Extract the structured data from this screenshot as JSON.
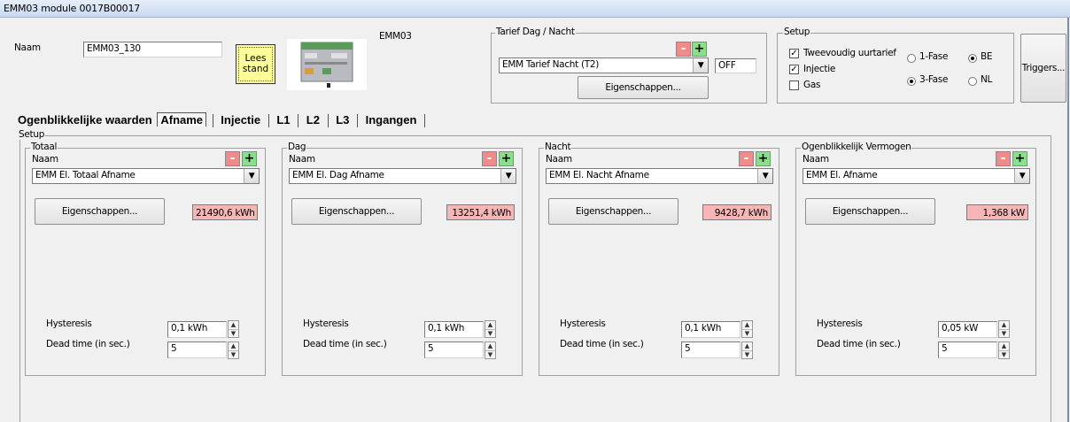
{
  "window": {
    "title": "EMM03 module 0017B00017"
  },
  "module": {
    "naam_label": "Naam",
    "naam_value": "EMM03_130",
    "lees_label_line1": "Lees",
    "lees_label_line2": "stand",
    "type_label": "EMM03"
  },
  "tarief": {
    "group_title": "Tarief Dag / Nacht",
    "selected": "EMM Tarief Nacht (T2)",
    "state": "OFF",
    "eigenschappen": "Eigenschappen..."
  },
  "setup_top": {
    "group_title": "Setup",
    "tweevoudig": "Tweevoudig uurtarief",
    "injectie": "Injectie",
    "gas": "Gas",
    "fase1": "1-Fase",
    "fase3": "3-Fase",
    "be": "BE",
    "nl": "NL",
    "tweevoudig_checked": true,
    "injectie_checked": true,
    "gas_checked": false,
    "fase_selected": "3-Fase",
    "land_selected": "BE"
  },
  "triggers_label": "Triggers...",
  "tabs": [
    "Ogenblikkelijke waarden",
    "Afname",
    "Injectie",
    "L1",
    "L2",
    "L3",
    "Ingangen"
  ],
  "active_tab": "Afname",
  "setup_title": "Setup",
  "panels": [
    {
      "title": "Totaal",
      "naam_label": "Naam",
      "selected": "EMM El. Totaal Afname",
      "eigenschappen": "Eigenschappen...",
      "value": "21490,6 kWh",
      "hysteresis_label": "Hysteresis",
      "hysteresis": "0,1 kWh",
      "dead_label": "Dead time (in sec.)",
      "dead": "5"
    },
    {
      "title": "Dag",
      "naam_label": "Naam",
      "selected": "EMM El. Dag Afname",
      "eigenschappen": "Eigenschappen...",
      "value": "13251,4 kWh",
      "hysteresis_label": "Hysteresis",
      "hysteresis": "0,1 kWh",
      "dead_label": "Dead time (in sec.)",
      "dead": "5"
    },
    {
      "title": "Nacht",
      "naam_label": "Naam",
      "selected": "EMM El. Nacht Afname",
      "eigenschappen": "Eigenschappen...",
      "value": "9428,7 kWh",
      "hysteresis_label": "Hysteresis",
      "hysteresis": "0,1 kWh",
      "dead_label": "Dead time (in sec.)",
      "dead": "5"
    },
    {
      "title": "Ogenblikkelijk Vermogen",
      "naam_label": "Naam",
      "selected": "EMM El. Afname",
      "eigenschappen": "Eigenschappen...",
      "value": "1,368 kW",
      "hysteresis_label": "Hysteresis",
      "hysteresis": "0,05 kW",
      "dead_label": "Dead time (in sec.)",
      "dead": "5"
    }
  ]
}
